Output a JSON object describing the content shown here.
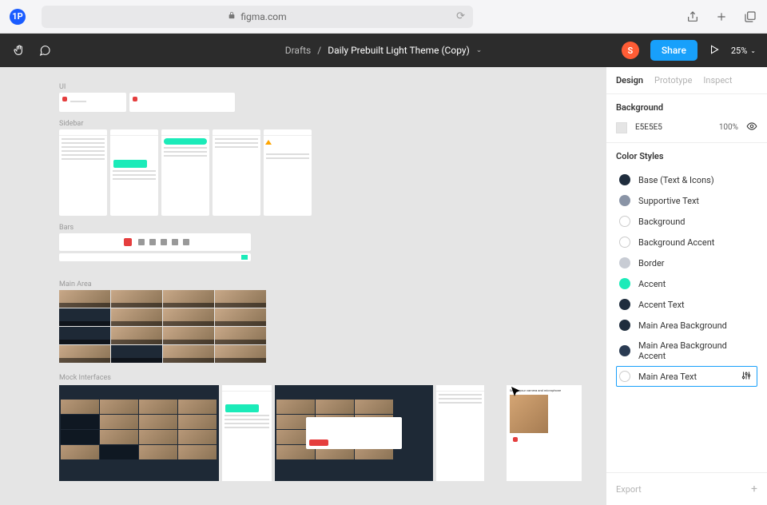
{
  "browser": {
    "url_host": "figma.com",
    "password_manager": "1P"
  },
  "header": {
    "breadcrumb_parent": "Drafts",
    "breadcrumb_separator": "/",
    "breadcrumb_current": "Daily Prebuilt Light Theme (Copy)",
    "avatar_initial": "S",
    "share_label": "Share",
    "zoom": "25%"
  },
  "canvas": {
    "sections": {
      "ui": "UI",
      "sidebar": "Sidebar",
      "bars": "Bars",
      "main_area": "Main Area",
      "mock": "Mock Interfaces"
    },
    "mock_setup_label": "Set up your camera and microphone"
  },
  "design_panel": {
    "tabs": {
      "design": "Design",
      "prototype": "Prototype",
      "inspect": "Inspect"
    },
    "background": {
      "title": "Background",
      "hex": "E5E5E5",
      "opacity": "100%"
    },
    "color_styles": {
      "title": "Color Styles",
      "items": [
        {
          "name": "Base (Text & Icons)",
          "color": "#1f2d3d"
        },
        {
          "name": "Supportive Text",
          "color": "#8a94a6"
        },
        {
          "name": "Background",
          "color": "#ffffff",
          "stroke": true
        },
        {
          "name": "Background Accent",
          "color": "#ffffff",
          "stroke": true
        },
        {
          "name": "Border",
          "color": "#c8ccd4"
        },
        {
          "name": "Accent",
          "color": "#1bebb9"
        },
        {
          "name": "Accent Text",
          "color": "#1f2d3d"
        },
        {
          "name": "Main Area Background",
          "color": "#1f2d3d"
        },
        {
          "name": "Main Area Background Accent",
          "color": "#2a3b52"
        },
        {
          "name": "Main Area Text",
          "color": "#ffffff",
          "stroke": true,
          "selected": true
        }
      ]
    },
    "export_label": "Export"
  }
}
